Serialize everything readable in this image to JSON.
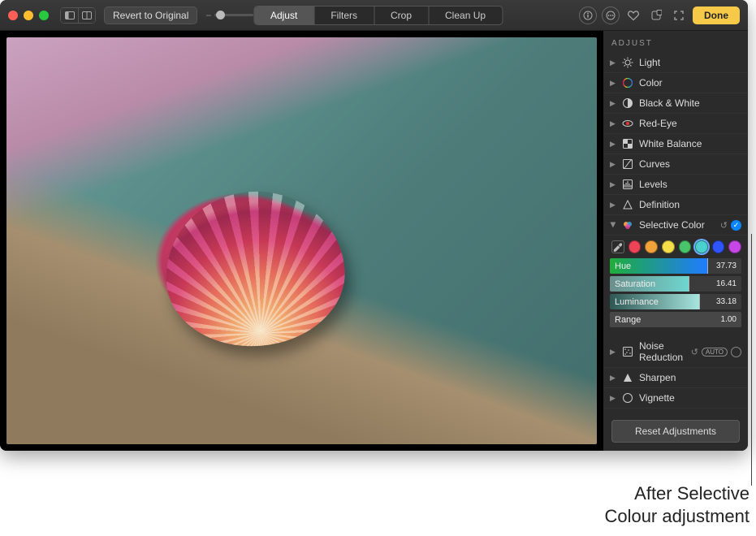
{
  "toolbar": {
    "revert_label": "Revert to Original",
    "tabs": [
      "Adjust",
      "Filters",
      "Crop",
      "Clean Up"
    ],
    "active_tab": "Adjust",
    "done_label": "Done"
  },
  "sidebar": {
    "header": "ADJUST",
    "items": [
      {
        "label": "Light",
        "icon": "light-icon"
      },
      {
        "label": "Color",
        "icon": "color-icon"
      },
      {
        "label": "Black & White",
        "icon": "bw-icon"
      },
      {
        "label": "Red-Eye",
        "icon": "redeye-icon"
      },
      {
        "label": "White Balance",
        "icon": "whitebalance-icon"
      },
      {
        "label": "Curves",
        "icon": "curves-icon"
      },
      {
        "label": "Levels",
        "icon": "levels-icon"
      },
      {
        "label": "Definition",
        "icon": "definition-icon"
      },
      {
        "label": "Selective Color",
        "icon": "selectivecolor-icon",
        "expanded": true,
        "checked": true,
        "reset": true
      },
      {
        "label": "Noise Reduction",
        "icon": "noise-icon",
        "auto": true,
        "hollow": true,
        "reset": true
      },
      {
        "label": "Sharpen",
        "icon": "sharpen-icon"
      },
      {
        "label": "Vignette",
        "icon": "vignette-icon"
      }
    ],
    "selective_color": {
      "swatches": [
        "#ef4458",
        "#f2a23a",
        "#f4df4a",
        "#49c46b",
        "#4bd0cf",
        "#2f55ff",
        "#c646e6"
      ],
      "selected_swatch_index": 4,
      "sliders": {
        "hue": {
          "label": "Hue",
          "value": "37.73",
          "fill": 0.74,
          "gradient": "linear-gradient(90deg,#1fae3a,#1f7bff)"
        },
        "saturation": {
          "label": "Saturation",
          "value": "16.41",
          "fill": 0.6,
          "gradient": "linear-gradient(90deg,#6b8f8c,#6fd6cf)"
        },
        "luminance": {
          "label": "Luminance",
          "value": "33.18",
          "fill": 0.68,
          "gradient": "linear-gradient(90deg,#2e5753,#a7e5df)"
        },
        "range": {
          "label": "Range",
          "value": "1.00",
          "fill": 1.0,
          "gradient": "#474747"
        }
      }
    },
    "reset_label": "Reset Adjustments"
  },
  "caption": {
    "line1": "After Selective",
    "line2": "Colour adjustment"
  }
}
